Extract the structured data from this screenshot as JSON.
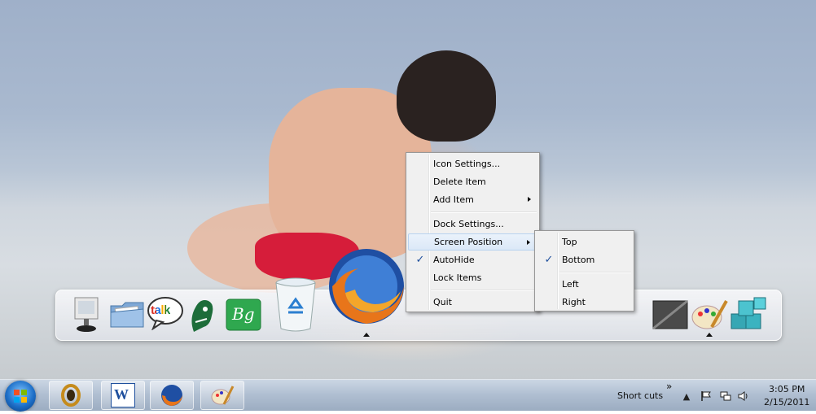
{
  "context_menu": {
    "items": [
      {
        "label": "Icon Settings...",
        "has_submenu": false,
        "checked": false
      },
      {
        "label": "Delete Item",
        "has_submenu": false,
        "checked": false
      },
      {
        "label": "Add Item",
        "has_submenu": true,
        "checked": false
      },
      {
        "label": "Dock Settings...",
        "has_submenu": false,
        "checked": false
      },
      {
        "label": "Screen Position",
        "has_submenu": true,
        "checked": false,
        "highlighted": true
      },
      {
        "label": "AutoHide",
        "has_submenu": false,
        "checked": true
      },
      {
        "label": "Lock Items",
        "has_submenu": false,
        "checked": false
      },
      {
        "label": "Quit",
        "has_submenu": false,
        "checked": false
      }
    ],
    "check_glyph": "✓"
  },
  "screen_position_submenu": {
    "items": [
      {
        "label": "Top",
        "checked": false
      },
      {
        "label": "Bottom",
        "checked": true
      },
      {
        "label": "Left",
        "checked": false
      },
      {
        "label": "Right",
        "checked": false
      }
    ]
  },
  "dock": {
    "icons": [
      "computer-icon",
      "folder-icon",
      "google-talk-icon",
      "green-app-icon",
      "green-bg-icon",
      "recycle-bin-icon",
      "firefox-icon",
      "dark-window-icon",
      "paint-icon",
      "cubes-icon"
    ],
    "talk_label": "talk",
    "bg_label": "Bg"
  },
  "taskbar": {
    "word_label": "W",
    "shortcuts_label": "Short cuts",
    "shortcuts_chevron": "»",
    "time": "3:05 PM",
    "date": "2/15/2011"
  },
  "colors": {
    "menu_bg": "#f0f0f0",
    "highlight": "#dbe8f7",
    "check": "#1e4f9d",
    "trunks": "#d61d3a",
    "firefox_orange": "#e8751a",
    "firefox_blue": "#1f4fa3"
  }
}
